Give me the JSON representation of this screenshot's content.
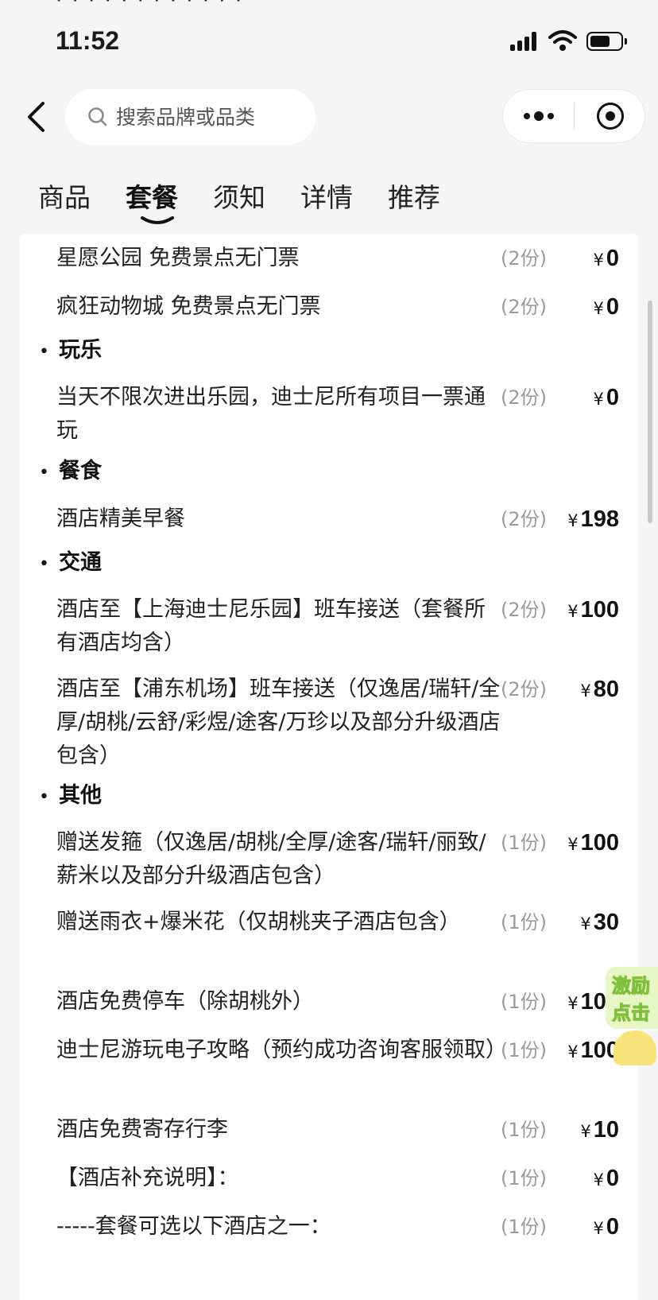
{
  "status_bar": {
    "time": "11:52"
  },
  "search": {
    "placeholder": "搜索品牌或品类"
  },
  "tabs": [
    {
      "label": "商品",
      "active": false
    },
    {
      "label": "套餐",
      "active": true
    },
    {
      "label": "须知",
      "active": false
    },
    {
      "label": "详情",
      "active": false
    },
    {
      "label": "推荐",
      "active": false
    }
  ],
  "currency": "¥",
  "items": [
    {
      "name": "星愿公园 免费景点无门票",
      "qty": "(2份)",
      "price": "0"
    },
    {
      "name": "疯狂动物城 免费景点无门票",
      "qty": "(2份)",
      "price": "0"
    },
    {
      "section": "玩乐"
    },
    {
      "name": "当天不限次进出乐园，迪士尼所有项目一票通玩",
      "qty": "(2份)",
      "price": "0"
    },
    {
      "section": "餐食"
    },
    {
      "name": "酒店精美早餐",
      "qty": "(2份)",
      "price": "198"
    },
    {
      "section": "交通"
    },
    {
      "name": "酒店至【上海迪士尼乐园】班车接送（套餐所有酒店均含）",
      "qty": "(2份)",
      "price": "100"
    },
    {
      "name": "酒店至【浦东机场】班车接送（仅逸居/瑞轩/全厚/胡桃/云舒/彩煜/途客/万珍以及部分升级酒店包含）",
      "qty": "(2份)",
      "price": "80"
    },
    {
      "section": "其他"
    },
    {
      "name": "赠送发箍（仅逸居/胡桃/全厚/途客/瑞轩/丽致/薪米以及部分升级酒店包含）",
      "qty": "(1份)",
      "price": "100"
    },
    {
      "name": "赠送雨衣+爆米花（仅胡桃夹子酒店包含）",
      "qty": "(1份)",
      "price": "30"
    },
    {
      "name": "酒店免费停车（除胡桃外）",
      "qty": "(1份)",
      "price": "100"
    },
    {
      "name": "迪士尼游玩电子攻略（预约成功咨询客服领取）",
      "qty": "(1份)",
      "price": "100"
    },
    {
      "name": "酒店免费寄存行李",
      "qty": "(1份)",
      "price": "10"
    },
    {
      "name": "【酒店补充说明】：",
      "qty": "(1份)",
      "price": "0"
    },
    {
      "name": "-----套餐可选以下酒店之一：",
      "qty": "(1份)",
      "price": "0"
    }
  ],
  "floater": {
    "line1": "激励",
    "line2": "点击"
  }
}
